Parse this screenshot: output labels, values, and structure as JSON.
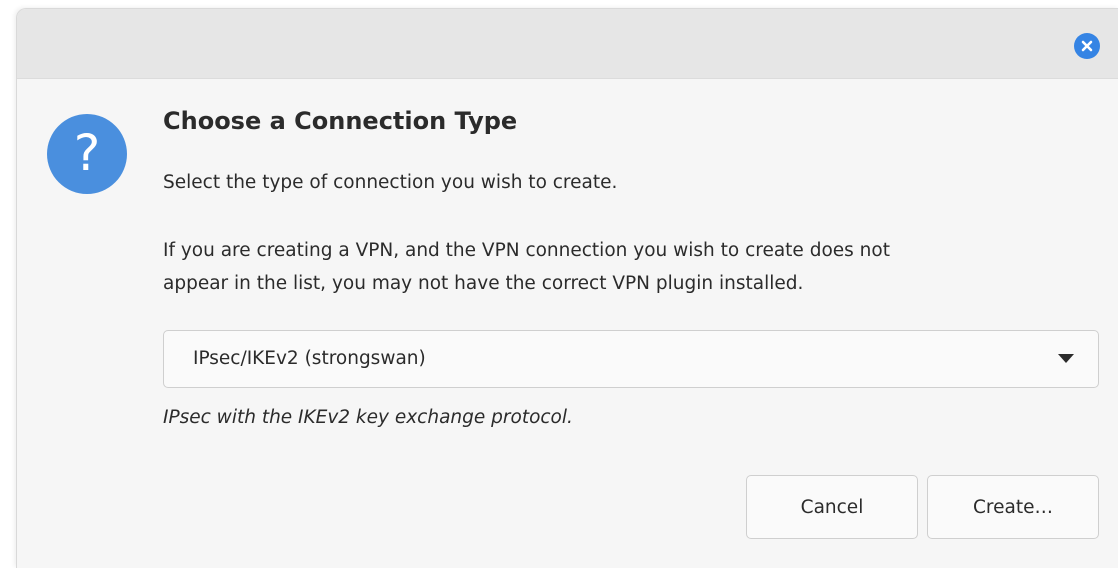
{
  "window": {
    "close_icon": "close-icon",
    "accent_color": "#3584e4"
  },
  "dialog": {
    "icon": "question-icon",
    "icon_glyph": "?",
    "title": "Choose a Connection Type",
    "subtitle": "Select the type of connection you wish to create.",
    "info_line1": "If you are creating a VPN, and the VPN connection you wish to create does not",
    "info_line2": "appear in the list, you may not have the correct VPN plugin installed.",
    "connection_type": {
      "selected": "IPsec/IKEv2 (strongswan)",
      "description": "IPsec with the IKEv2 key exchange protocol."
    },
    "buttons": {
      "cancel": "Cancel",
      "create": "Create…"
    }
  }
}
